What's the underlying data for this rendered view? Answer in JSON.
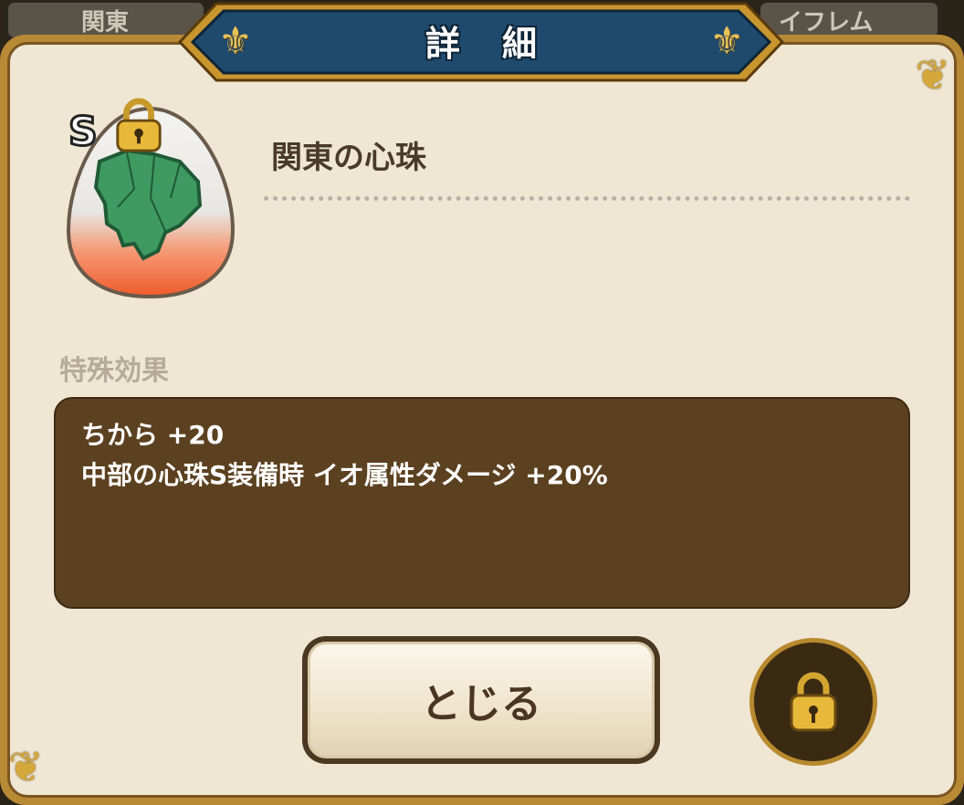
{
  "background_tabs": {
    "left_label": "関東",
    "right_label": "イフレム"
  },
  "dialog": {
    "title": "詳細",
    "item": {
      "name": "関東の心珠",
      "rank": "S",
      "locked": true
    },
    "section_label": "特殊効果",
    "effects": [
      "ちから +20",
      "中部の心珠S装備時 イオ属性ダメージ +20%"
    ],
    "close_label": "とじる"
  },
  "colors": {
    "panel_bg": "#efe7d4",
    "frame_gold": "#b88a35",
    "banner_blue": "#1f4a6e",
    "effect_box": "#5c4120",
    "text_dark": "#4a3a28"
  },
  "icons": [
    "lock-icon",
    "region-map-icon",
    "fleur-de-lis-icon"
  ]
}
